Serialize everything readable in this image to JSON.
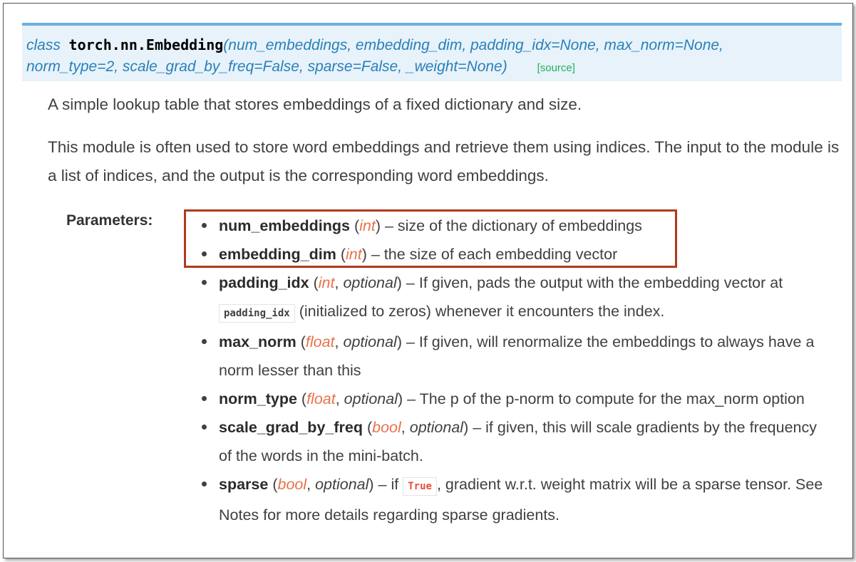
{
  "signature": {
    "keyword": "class",
    "name": "torch.nn.Embedding",
    "args_line1": "(num_embeddings, embedding_dim, padding_idx=None, max_norm=None,",
    "args_line2": "norm_type=2, scale_grad_by_freq=False, sparse=False, _weight=None)",
    "source_link": "[source]"
  },
  "description": {
    "line1": "A simple lookup table that stores embeddings of a fixed dictionary and size.",
    "line2": "This module is often used to store word embeddings and retrieve them using indices. The input to the module is a list of indices, and the output is the corresponding word embeddings."
  },
  "parameters_label": "Parameters:",
  "params": [
    {
      "name": "num_embeddings",
      "type": "int",
      "desc": " – size of the dictionary of embeddings"
    },
    {
      "name": "embedding_dim",
      "type": "int",
      "desc": " – the size of each embedding vector"
    },
    {
      "name": "padding_idx",
      "type": "int",
      "optional": "optional",
      "desc_a": " – If given, pads the output with the embedding vector at ",
      "code": "padding_idx",
      "desc_b": " (initialized to zeros) whenever it encounters the index."
    },
    {
      "name": "max_norm",
      "type": "float",
      "optional": "optional",
      "desc": " – If given, will renormalize the embeddings to always have a norm lesser than this"
    },
    {
      "name": "norm_type",
      "type": "float",
      "optional": "optional",
      "desc": " – The p of the p-norm to compute for the max_norm option"
    },
    {
      "name": "scale_grad_by_freq",
      "type": "bool",
      "optional": "optional",
      "desc": " – if given, this will scale gradients by the frequency of the words in the mini-batch."
    },
    {
      "name": "sparse",
      "type": "bool",
      "optional": "optional",
      "desc_a": " – if ",
      "code": "True",
      "desc_b": ", gradient w.r.t. weight matrix will be a sparse tensor. See Notes for more details regarding sparse gradients."
    }
  ],
  "colors": {
    "accent": "#2980b9",
    "signature_bg": "#e7f2fa",
    "type": "#e9714a",
    "highlight": "#b03a1e"
  }
}
